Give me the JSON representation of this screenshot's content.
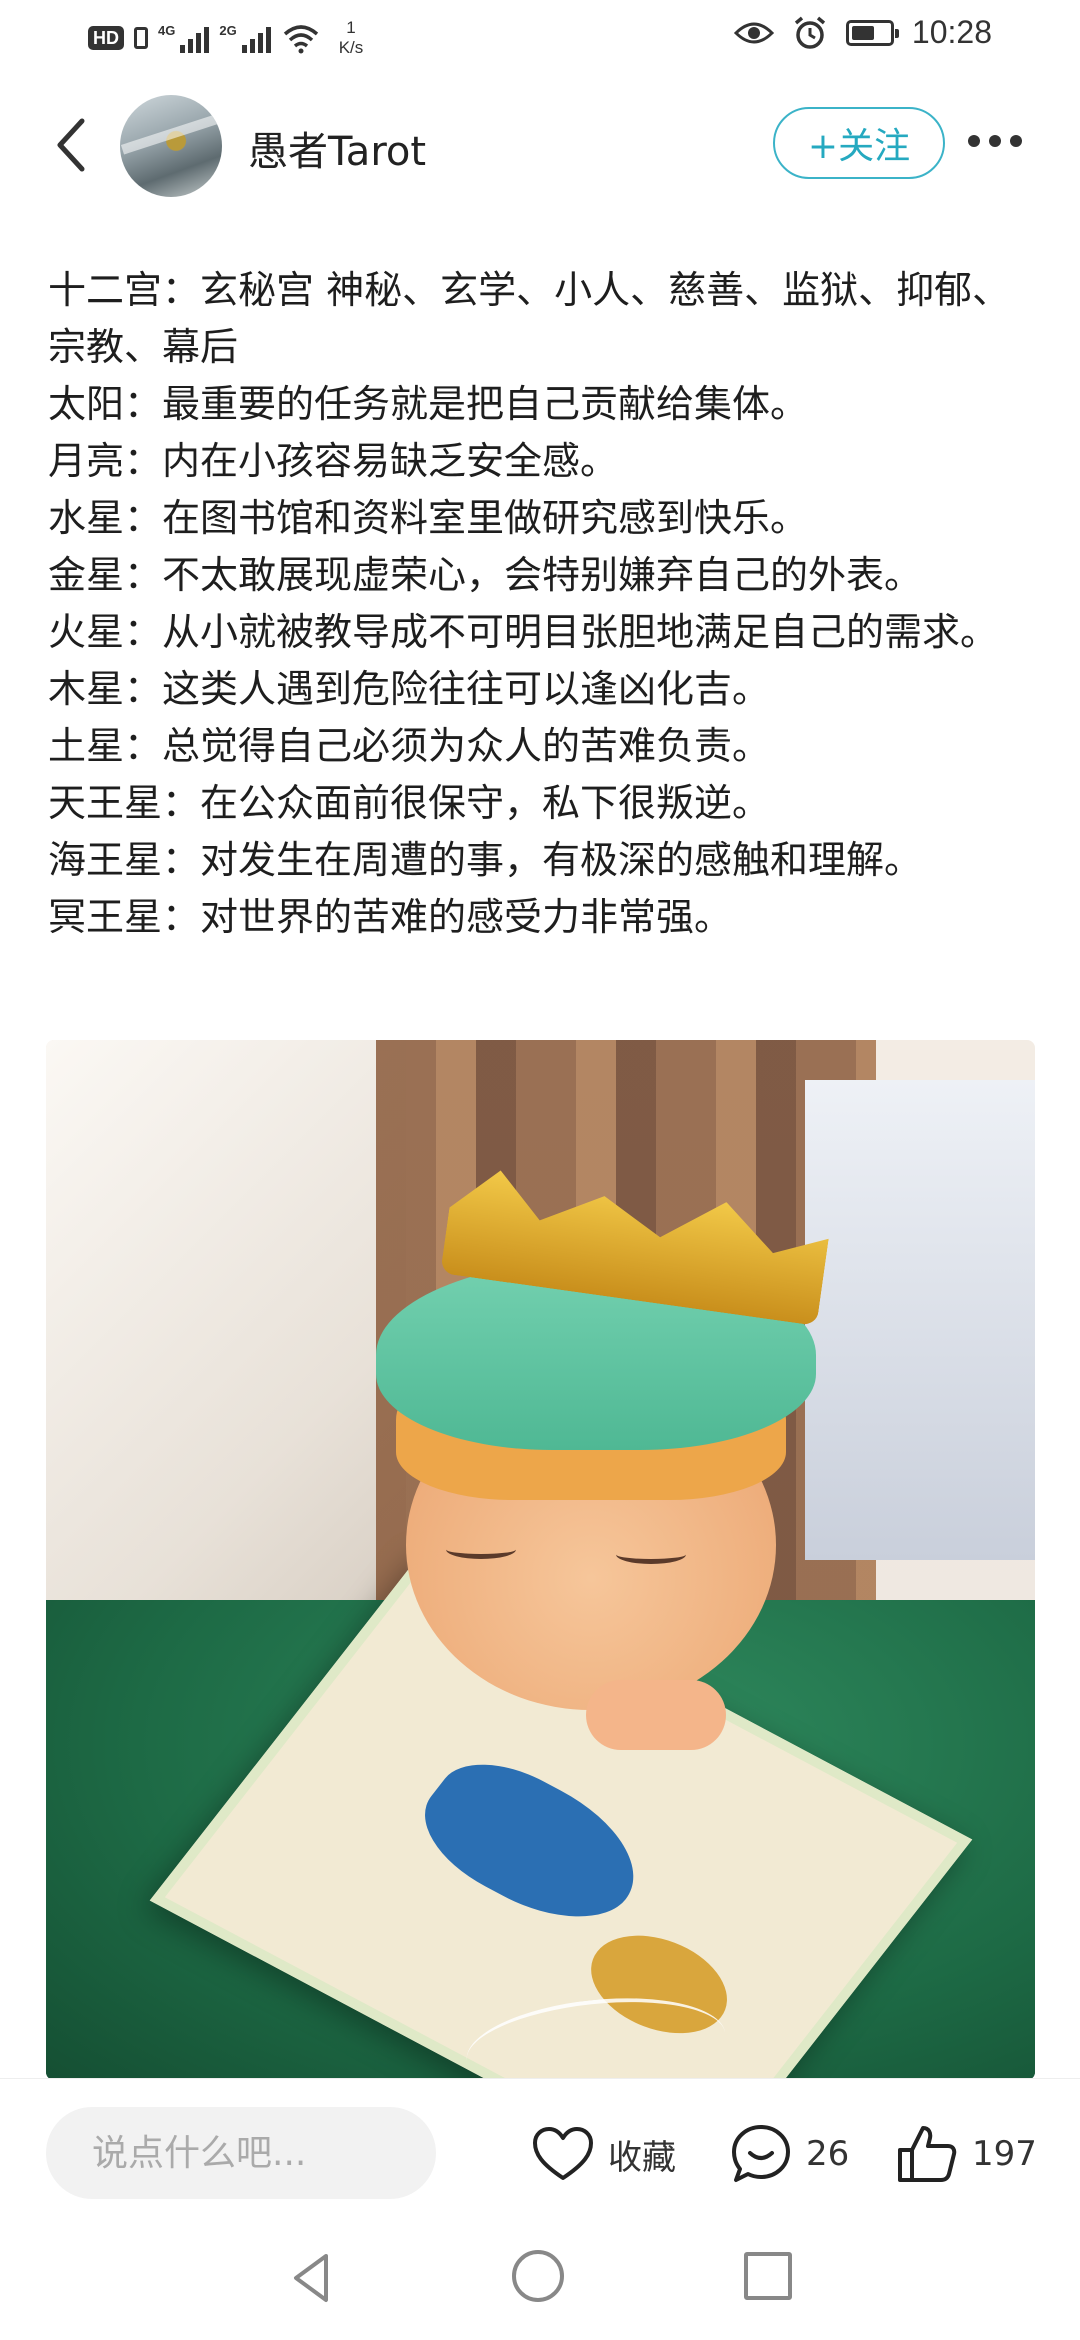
{
  "status_bar": {
    "hd": "HD",
    "net1": "4G",
    "net2": "2G",
    "speed_value": "1",
    "speed_unit": "K/s",
    "time": "10:28",
    "battery_level": 0.6
  },
  "header": {
    "username": "愚者Tarot",
    "follow_label": "+关注"
  },
  "post": {
    "lines": [
      "十二宫：玄秘宫 神秘、玄学、小人、慈善、监狱、抑郁、宗教、幕后",
      "太阳：最重要的任务就是把自己贡献给集体。",
      "月亮：内在小孩容易缺乏安全感。",
      "水星：在图书馆和资料室里做研究感到快乐。",
      "金星：不太敢展现虚荣心，会特别嫌弃自己的外表。",
      "火星：从小就被教导成不可明目张胆地满足自己的需求。",
      "木星：这类人遇到危险往往可以逢凶化吉。",
      "土星：总觉得自己必须为众人的苦难负责。",
      "天王星：在公众面前很保守，私下很叛逆。",
      "海王星：对发生在周遭的事，有极深的感触和理解。",
      "冥王星：对世界的苦难的感受力非常强。"
    ]
  },
  "bottom_bar": {
    "comment_placeholder": "说点什么吧...",
    "favorite_label": "收藏",
    "comment_count": "26",
    "like_count": "197"
  },
  "icons": {
    "back": "chevron-left-icon",
    "more": "more-dots-icon",
    "favorite": "heart-icon",
    "comment": "comment-bubble-icon",
    "like": "thumbs-up-icon"
  }
}
